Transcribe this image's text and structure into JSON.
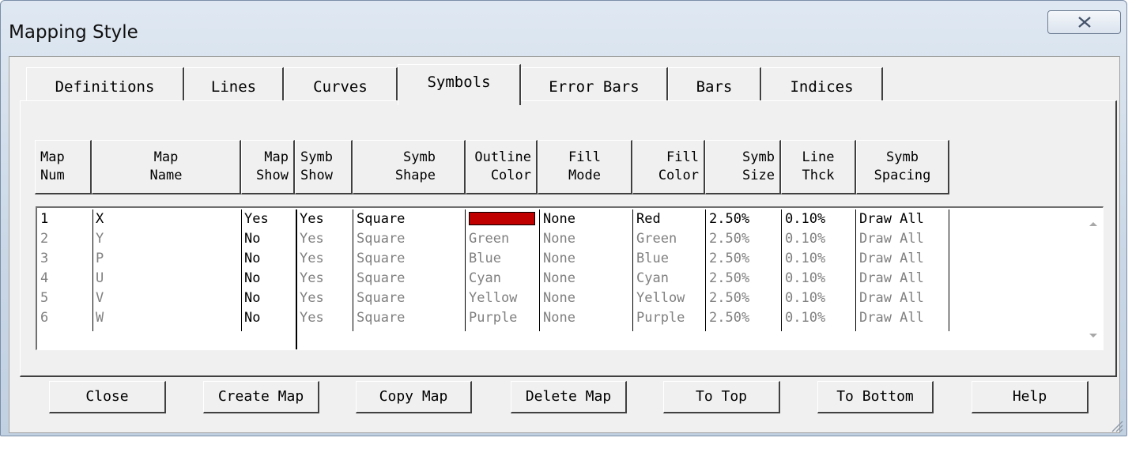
{
  "window": {
    "title": "Mapping Style"
  },
  "tabs": [
    "Definitions",
    "Lines",
    "Curves",
    "Symbols",
    "Error Bars",
    "Bars",
    "Indices"
  ],
  "active_tab": "Symbols",
  "columns": [
    "Map\nNum",
    "Map\nName",
    "Map\nShow",
    "Symb\nShow",
    "Symb\nShape",
    "Outline\nColor",
    "Fill\nMode",
    "Fill\nColor",
    "Symb\nSize",
    "Line\nThck",
    "Symb\nSpacing"
  ],
  "rows": [
    {
      "num": "1",
      "name": "X",
      "map_show": "Yes",
      "symb_show": "Yes",
      "shape": "Square",
      "outline": "",
      "fill_mode": "None",
      "fill_color": "Red",
      "size": "2.50%",
      "thck": "0.10%",
      "spacing": "Draw All",
      "selected": true
    },
    {
      "num": "2",
      "name": "Y",
      "map_show": "No",
      "symb_show": "Yes",
      "shape": "Square",
      "outline": "Green",
      "fill_mode": "None",
      "fill_color": "Green",
      "size": "2.50%",
      "thck": "0.10%",
      "spacing": "Draw All"
    },
    {
      "num": "3",
      "name": "P",
      "map_show": "No",
      "symb_show": "Yes",
      "shape": "Square",
      "outline": "Blue",
      "fill_mode": "None",
      "fill_color": "Blue",
      "size": "2.50%",
      "thck": "0.10%",
      "spacing": "Draw All"
    },
    {
      "num": "4",
      "name": "U",
      "map_show": "No",
      "symb_show": "Yes",
      "shape": "Square",
      "outline": "Cyan",
      "fill_mode": "None",
      "fill_color": "Cyan",
      "size": "2.50%",
      "thck": "0.10%",
      "spacing": "Draw All"
    },
    {
      "num": "5",
      "name": "V",
      "map_show": "No",
      "symb_show": "Yes",
      "shape": "Square",
      "outline": "Yellow",
      "fill_mode": "None",
      "fill_color": "Yellow",
      "size": "2.50%",
      "thck": "0.10%",
      "spacing": "Draw All"
    },
    {
      "num": "6",
      "name": "W",
      "map_show": "No",
      "symb_show": "Yes",
      "shape": "Square",
      "outline": "Purple",
      "fill_mode": "None",
      "fill_color": "Purple",
      "size": "2.50%",
      "thck": "0.10%",
      "spacing": "Draw All"
    }
  ],
  "selected_outline_swatch": "#c00000",
  "buttons": {
    "close": "Close",
    "create_map": "Create Map",
    "copy_map": "Copy Map",
    "delete_map": "Delete Map",
    "to_top": "To Top",
    "to_bottom": "To Bottom",
    "help": "Help"
  }
}
